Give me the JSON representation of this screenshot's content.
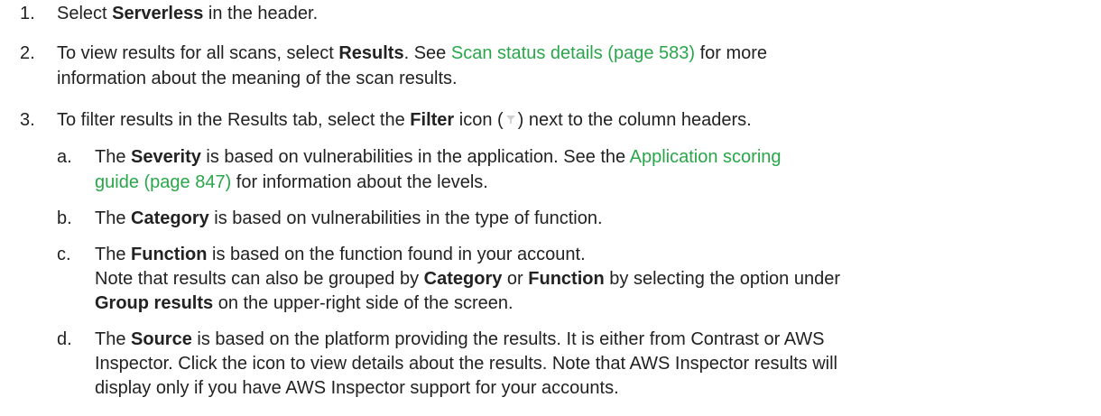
{
  "steps": {
    "s1": {
      "num": "1.",
      "pre": "Select ",
      "bold": "Serverless",
      "post": " in the header."
    },
    "s2": {
      "num": "2.",
      "pre": "To view results for all scans, select ",
      "bold": "Results",
      "mid": ". See ",
      "link": "Scan status details (page 583)",
      "post": " for more",
      "line2": "information about the meaning of the scan results."
    },
    "s3": {
      "num": "3.",
      "pre": "To filter results in the Results tab, select the ",
      "bold": "Filter",
      "mid": " icon (",
      "post": ") next to the column headers."
    },
    "sa": {
      "num": "a.",
      "pre": "The ",
      "bold": "Severity",
      "mid": " is based on vulnerabilities in the application. See the ",
      "link1": "Application scoring",
      "link2": "guide (page 847)",
      "post": " for information about the levels."
    },
    "sb": {
      "num": "b.",
      "pre": "The ",
      "bold": "Category",
      "post": " is based on vulnerabilities in the type of function."
    },
    "sc": {
      "num": "c.",
      "pre": "The ",
      "bold": "Function",
      "post": " is based on the function found in your account.",
      "note_pre": "Note that results can also be grouped by ",
      "note_b1": "Category",
      "note_or": " or ",
      "note_b2": "Function",
      "note_post": " by selecting the option under",
      "note_b3": "Group results",
      "note_end": " on the upper-right side of the screen."
    },
    "sd": {
      "num": "d.",
      "pre": "The ",
      "bold": "Source",
      "post": " is based on the platform providing the results. It is either from Contrast or AWS",
      "line2": "Inspector. Click the icon to view details about the results. Note that AWS Inspector results will",
      "line3": "display only if you have AWS Inspector support for your accounts."
    }
  },
  "icons": {
    "filter": "filter-icon"
  }
}
